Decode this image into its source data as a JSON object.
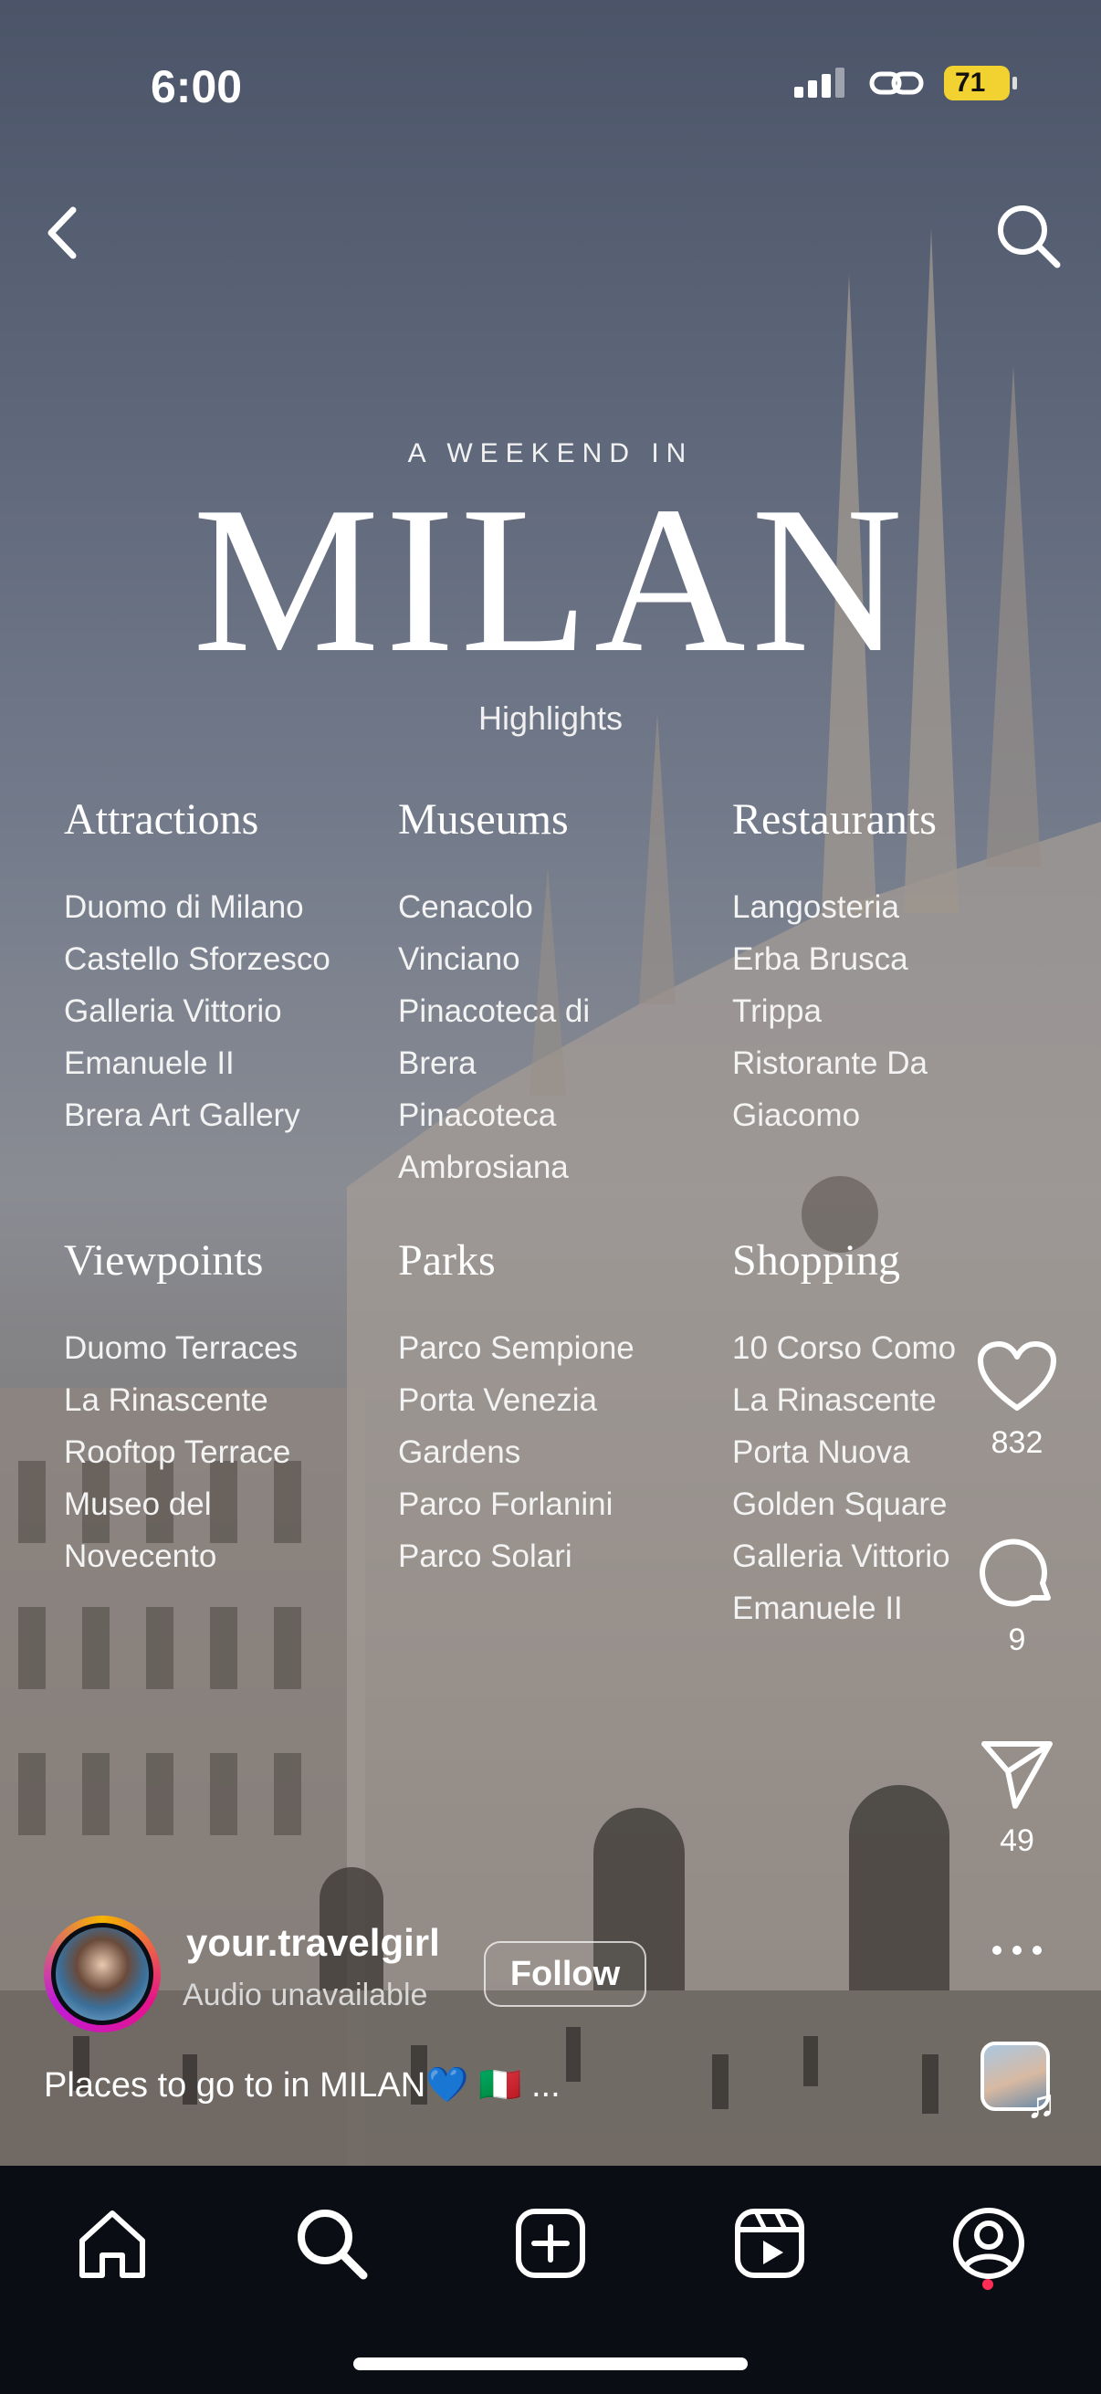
{
  "status_bar": {
    "time": "6:00",
    "battery": "71",
    "icons": [
      "signal-icon",
      "link-icon",
      "battery-icon"
    ]
  },
  "top_bar": {
    "back_icon": "chevron-left-icon",
    "search_icon": "search-icon"
  },
  "reel": {
    "kicker": "A WEEKEND IN",
    "title": "MILAN",
    "subtitle": "Highlights",
    "sections": [
      {
        "heading": "Attractions",
        "lines": [
          "Duomo di Milano",
          "Castello Sforzesco",
          "Galleria Vittorio",
          "Emanuele II",
          "Brera Art Gallery"
        ]
      },
      {
        "heading": "Museums",
        "lines": [
          "Cenacolo",
          "Vinciano",
          "Pinacoteca di",
          "Brera",
          "Pinacoteca",
          "Ambrosiana"
        ]
      },
      {
        "heading": "Restaurants",
        "lines": [
          "Langosteria",
          "Erba Brusca",
          "Trippa",
          "Ristorante Da",
          "Giacomo"
        ]
      },
      {
        "heading": "Viewpoints",
        "lines": [
          "Duomo Terraces",
          "La Rinascente",
          "Rooftop Terrace",
          "Museo del",
          "Novecento"
        ]
      },
      {
        "heading": "Parks",
        "lines": [
          "Parco Sempione",
          "Porta Venezia",
          "Gardens",
          "Parco Forlanini",
          "Parco Solari"
        ]
      },
      {
        "heading": "Shopping",
        "lines": [
          "10 Corso Como",
          "La Rinascente",
          "Porta Nuova",
          "Golden Square",
          "Galleria Vittorio",
          "Emanuele II"
        ]
      }
    ]
  },
  "actions": {
    "likes": "832",
    "comments": "9",
    "shares": "49"
  },
  "author": {
    "username": "your.travelgirl",
    "audio_note": "Audio unavailable",
    "follow_label": "Follow"
  },
  "caption": "Places to go to in MILAN💙 🇮🇹  ...",
  "bottom_nav": {
    "items": [
      "home-icon",
      "search-icon",
      "create-icon",
      "reels-icon",
      "profile-icon"
    ]
  },
  "colors": {
    "battery": "#f2d231",
    "nav_bg": "#0b0d14",
    "notification_dot": "#ff2d55"
  }
}
